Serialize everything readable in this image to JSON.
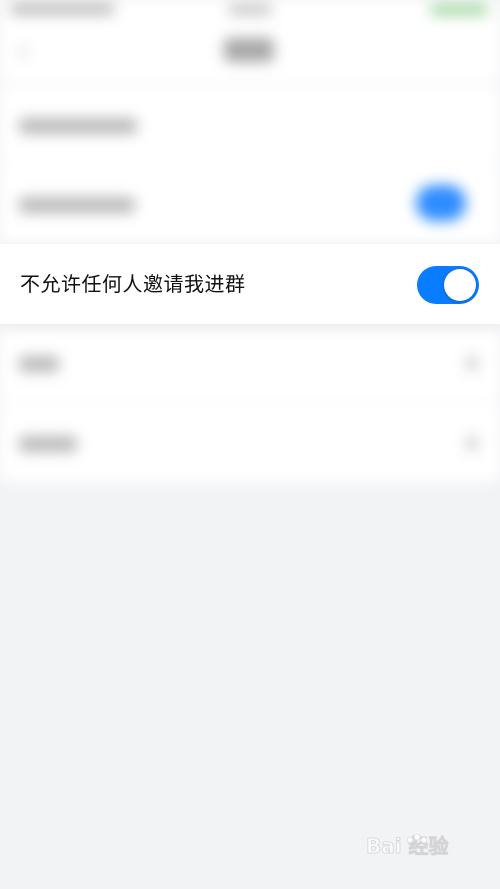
{
  "setting": {
    "label": "不允许任何人邀请我进群",
    "toggle_on": true
  },
  "colors": {
    "accent": "#0a7cff",
    "background": "#f2f3f5",
    "row": "#ffffff"
  },
  "watermark": {
    "text": "Bai 经验"
  }
}
